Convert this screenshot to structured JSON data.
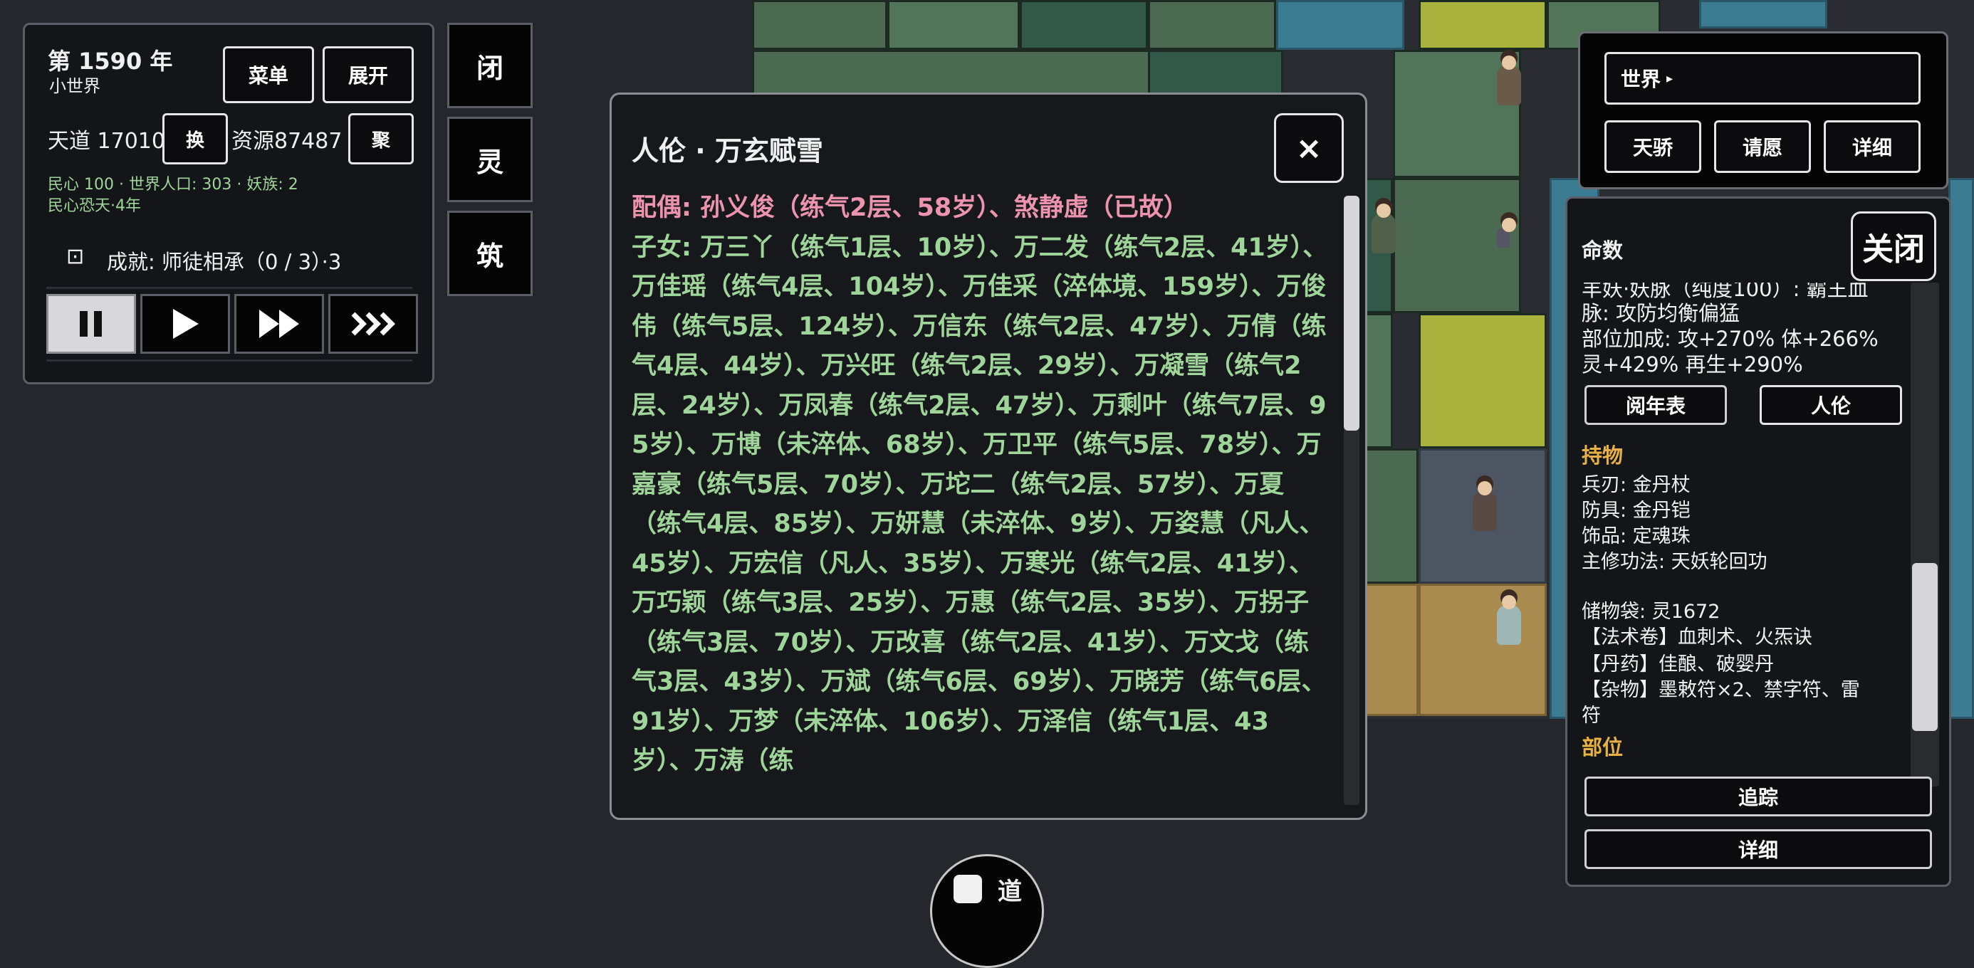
{
  "colors": {
    "spouse": "#ec93ad",
    "children": "#9fd59a",
    "section_header": "#e7b143"
  },
  "top_left": {
    "year": "第 1590 年",
    "world_name": "小世界",
    "menu_label": "菜单",
    "expand_label": "展开",
    "tiandao": "天道 17010",
    "swap_label": "换",
    "resources": "资源87487",
    "gather_label": "聚",
    "stats_line1": "民心 100 · 世界人口: 303 · 妖族: 2",
    "stats_line2": "民心恐天·4年",
    "achievement": "成就: 师徒相承（0 / 3）·3",
    "achievement_icon": "scroll-icon",
    "speed_buttons": [
      "pause-icon",
      "play-icon",
      "fast-forward-icon",
      "triple-forward-icon"
    ]
  },
  "side_buttons": [
    "闭",
    "灵",
    "筑"
  ],
  "dialog": {
    "title": "人伦 · 万玄赋雪",
    "close_label": "×",
    "spouse": "配偶: 孙义俊（练气2层、58岁）、煞静虚（已故）",
    "children": "子女: 万三丫（练气1层、10岁）、万二发（练气2层、41岁）、万佳瑶（练气4层、104岁）、万佳采（淬体境、159岁）、万俊伟（练气5层、124岁）、万信东（练气2层、47岁）、万倩（练气4层、44岁）、万兴旺（练气2层、29岁）、万凝雪（练气2层、24岁）、万凤春（练气2层、47岁）、万剩叶（练气7层、95岁）、万博（未淬体、68岁）、万卫平（练气5层、78岁）、万嘉豪（练气5层、70岁）、万坨二（练气2层、57岁）、万夏（练气4层、85岁）、万妍慧（未淬体、9岁）、万姿慧（凡人、45岁）、万宏信（凡人、35岁）、万寒光（练气2层、41岁）、万巧颖（练气3层、25岁）、万惠（练气2层、35岁）、万拐子（练气3层、70岁）、万改喜（练气2层、41岁）、万文戈（练气3层、43岁）、万斌（练气6层、69岁）、万晓芳（练气6层、91岁）、万梦（未淬体、106岁）、万泽信（练气1层、43岁）、万涛（练"
  },
  "world_panel": {
    "world_label": "世界",
    "tabs": [
      "天骄",
      "请愿",
      "详细"
    ]
  },
  "info_panel": {
    "title": "命数",
    "close_label": "关闭",
    "lines_top": [
      "羊妖·妖脉（纯度100）: 霸王血",
      "脉: 攻防均衡偏猛",
      "部位加成: 攻+270% 体+266%",
      "灵+429% 再生+290%"
    ],
    "tab_chronicle": "阅年表",
    "tab_relations": "人伦",
    "holdings_header": "持物",
    "holdings": [
      "兵刃: 金丹杖",
      "防具: 金丹铠",
      "饰品: 定魂珠",
      "主修功法: 天妖轮回功"
    ],
    "storage": "储物袋: 灵1672",
    "storage_items": [
      "【法术卷】血刺术、火炁诀",
      "【丹药】佳酿、破婴丹",
      "【杂物】墨敕符×2、禁字符、雷",
      "符"
    ],
    "parts_header": "部位",
    "track_label": "追踪",
    "detail_label": "详细"
  },
  "bottom_button": {
    "label": "道"
  }
}
